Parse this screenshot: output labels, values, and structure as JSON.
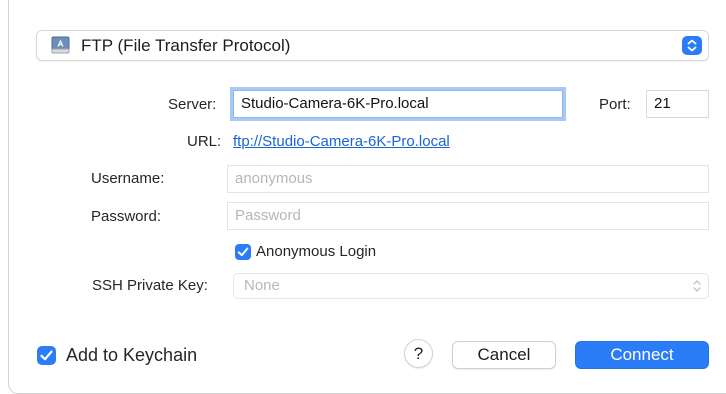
{
  "protocol": {
    "selected": "FTP (File Transfer Protocol)",
    "icon": "server-drive-icon"
  },
  "server": {
    "label": "Server:",
    "value": "Studio-Camera-6K-Pro.local"
  },
  "port": {
    "label": "Port:",
    "value": "21"
  },
  "url": {
    "label": "URL:",
    "value": "ftp://Studio-Camera-6K-Pro.local"
  },
  "username": {
    "label": "Username:",
    "placeholder": "anonymous"
  },
  "password": {
    "label": "Password:",
    "placeholder": "Password"
  },
  "anonymous_login": {
    "label": "Anonymous Login",
    "checked": true
  },
  "ssh_key": {
    "label": "SSH Private Key:",
    "selected": "None"
  },
  "keychain": {
    "label": "Add to Keychain",
    "checked": true
  },
  "buttons": {
    "help": "?",
    "cancel": "Cancel",
    "connect": "Connect"
  },
  "colors": {
    "accent": "#2b7cf7",
    "link": "#1b64d8"
  }
}
